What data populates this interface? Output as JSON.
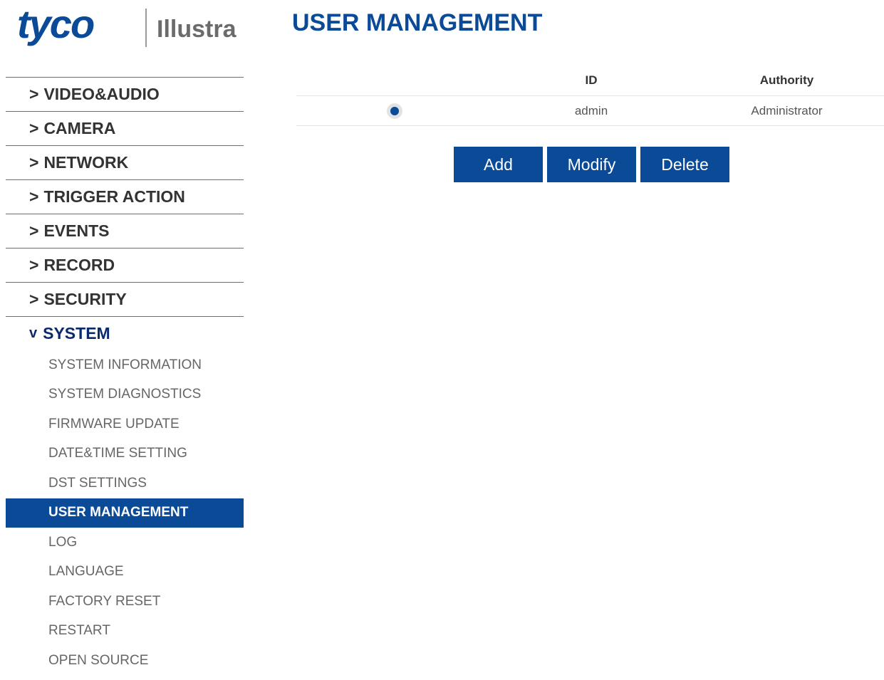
{
  "logo": {
    "brand": "tyco",
    "product": "Illustra"
  },
  "page_title": "USER MANAGEMENT",
  "sidebar": {
    "items": [
      {
        "chevron": ">",
        "label": "VIDEO&AUDIO"
      },
      {
        "chevron": ">",
        "label": "CAMERA"
      },
      {
        "chevron": ">",
        "label": "NETWORK"
      },
      {
        "chevron": ">",
        "label": "TRIGGER ACTION"
      },
      {
        "chevron": ">",
        "label": "EVENTS"
      },
      {
        "chevron": ">",
        "label": "RECORD"
      },
      {
        "chevron": ">",
        "label": "SECURITY"
      }
    ],
    "open_section": {
      "chevron": "v",
      "label": "SYSTEM",
      "subitems": [
        "SYSTEM INFORMATION",
        "SYSTEM DIAGNOSTICS",
        "FIRMWARE UPDATE",
        "DATE&TIME SETTING",
        "DST SETTINGS",
        "USER MANAGEMENT",
        "LOG",
        "LANGUAGE",
        "FACTORY RESET",
        "RESTART",
        "OPEN SOURCE"
      ],
      "active": "USER MANAGEMENT"
    }
  },
  "table": {
    "headers": [
      "",
      "ID",
      "Authority"
    ],
    "rows": [
      {
        "selected": true,
        "id": "admin",
        "authority": "Administrator"
      }
    ]
  },
  "buttons": {
    "add": "Add",
    "modify": "Modify",
    "delete": "Delete"
  },
  "colors": {
    "accent": "#0a4a96",
    "text": "#333333",
    "subtext": "#666666"
  }
}
